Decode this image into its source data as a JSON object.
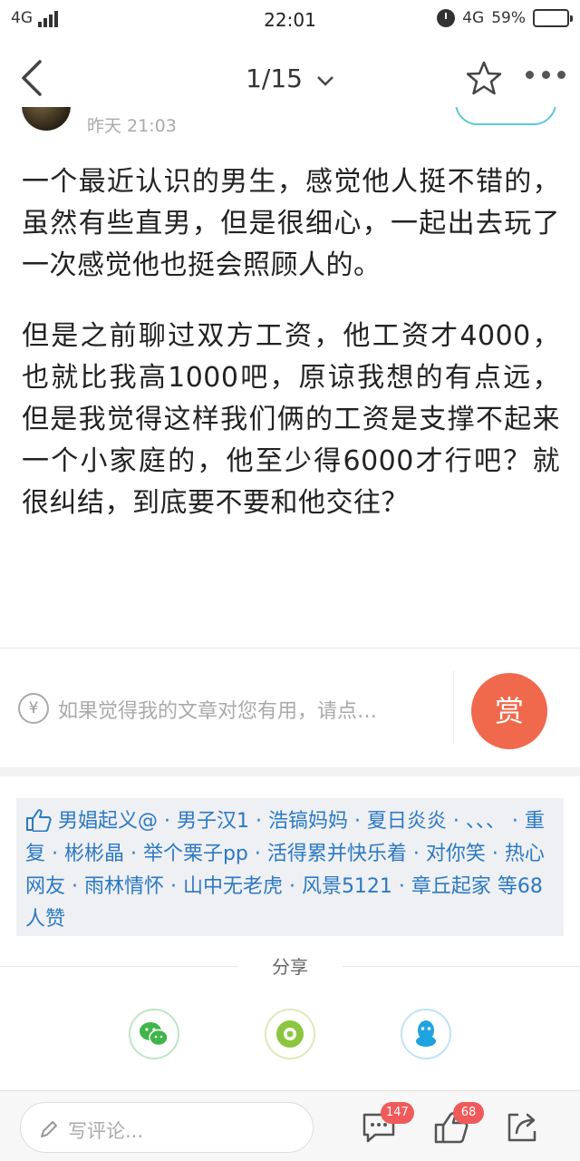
{
  "status_bar": {
    "network_left": "4G",
    "time": "22:01",
    "network_right": "4G",
    "battery_percent": "59%",
    "battery_level": 0.59
  },
  "nav": {
    "page_indicator": "1/15",
    "chevron": "⌄"
  },
  "post": {
    "time": "昨天 21:03",
    "paragraphs": [
      "一个最近认识的男生，感觉他人挺不错的，虽然有些直男，但是很细心，一起出去玩了一次感觉他也挺会照顾人的。",
      "但是之前聊过双方工资，他工资才4000，也就比我高1000吧，原谅我想的有点远，但是我觉得这样我们俩的工资是支撑不起来一个小家庭的，他至少得6000才行吧？就很纠结，到底要不要和他交往？"
    ]
  },
  "reward": {
    "yen_symbol": "¥",
    "prompt": "如果觉得我的文章对您有用，请点…",
    "button_label": "赏"
  },
  "likes": {
    "text": "男娼起义@ · 男子汉1 · 浩镐妈妈 · 夏日炎炎 · 、、、 · 重复 · 彬彬晶 · 举个栗子pp · 活得累并快乐着 · 对你笑 · 热心网友 · 雨林情怀 · 山中无老虎 · 风景5121 · 章丘起家 等68人赞"
  },
  "share": {
    "label": "分享",
    "icons": [
      "wechat-icon",
      "moments-icon",
      "qq-icon"
    ]
  },
  "bottom_bar": {
    "comment_placeholder": "写评论...",
    "comment_count": "147",
    "like_count": "68"
  },
  "colors": {
    "accent_blue": "#2c79c4",
    "reward_orange": "#f0694c",
    "badge_red": "#f05a5a",
    "wechat_green": "#3fb54a",
    "moments_green": "#8cc63f",
    "qq_blue": "#1fa3e0"
  }
}
